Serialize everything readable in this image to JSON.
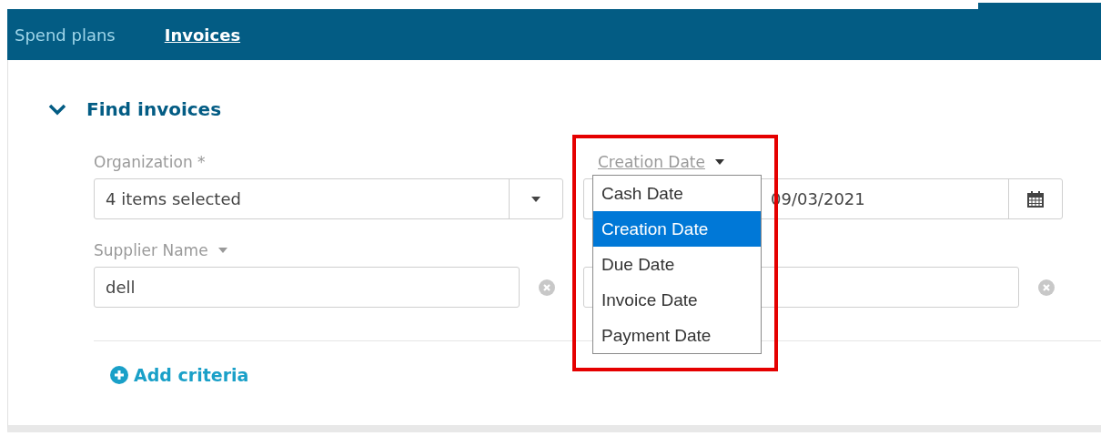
{
  "nav": {
    "tabs": [
      {
        "label": "Spend plans",
        "selected": false
      },
      {
        "label": "Invoices",
        "selected": true
      }
    ]
  },
  "section": {
    "title": "Find invoices",
    "expanded": true,
    "fields": [
      {
        "kind": "multiselect",
        "label": "Organization *",
        "value": "4 items selected"
      },
      {
        "kind": "date",
        "label": "Creation Date",
        "value": "09/03/2021",
        "label_menu": true,
        "menu_open": true
      },
      {
        "kind": "text",
        "label": "Supplier Name",
        "value": "dell",
        "label_menu": true,
        "clearable": true
      },
      {
        "kind": "text",
        "clearable": true
      }
    ],
    "date_menu": {
      "options": [
        {
          "label": "Cash Date",
          "selected": false
        },
        {
          "label": "Creation Date",
          "selected": true
        },
        {
          "label": "Due Date",
          "selected": false
        },
        {
          "label": "Invoice Date",
          "selected": false
        },
        {
          "label": "Payment Date",
          "selected": false
        }
      ]
    },
    "add_criteria": "Add criteria"
  },
  "annotation": {
    "frame": true
  }
}
